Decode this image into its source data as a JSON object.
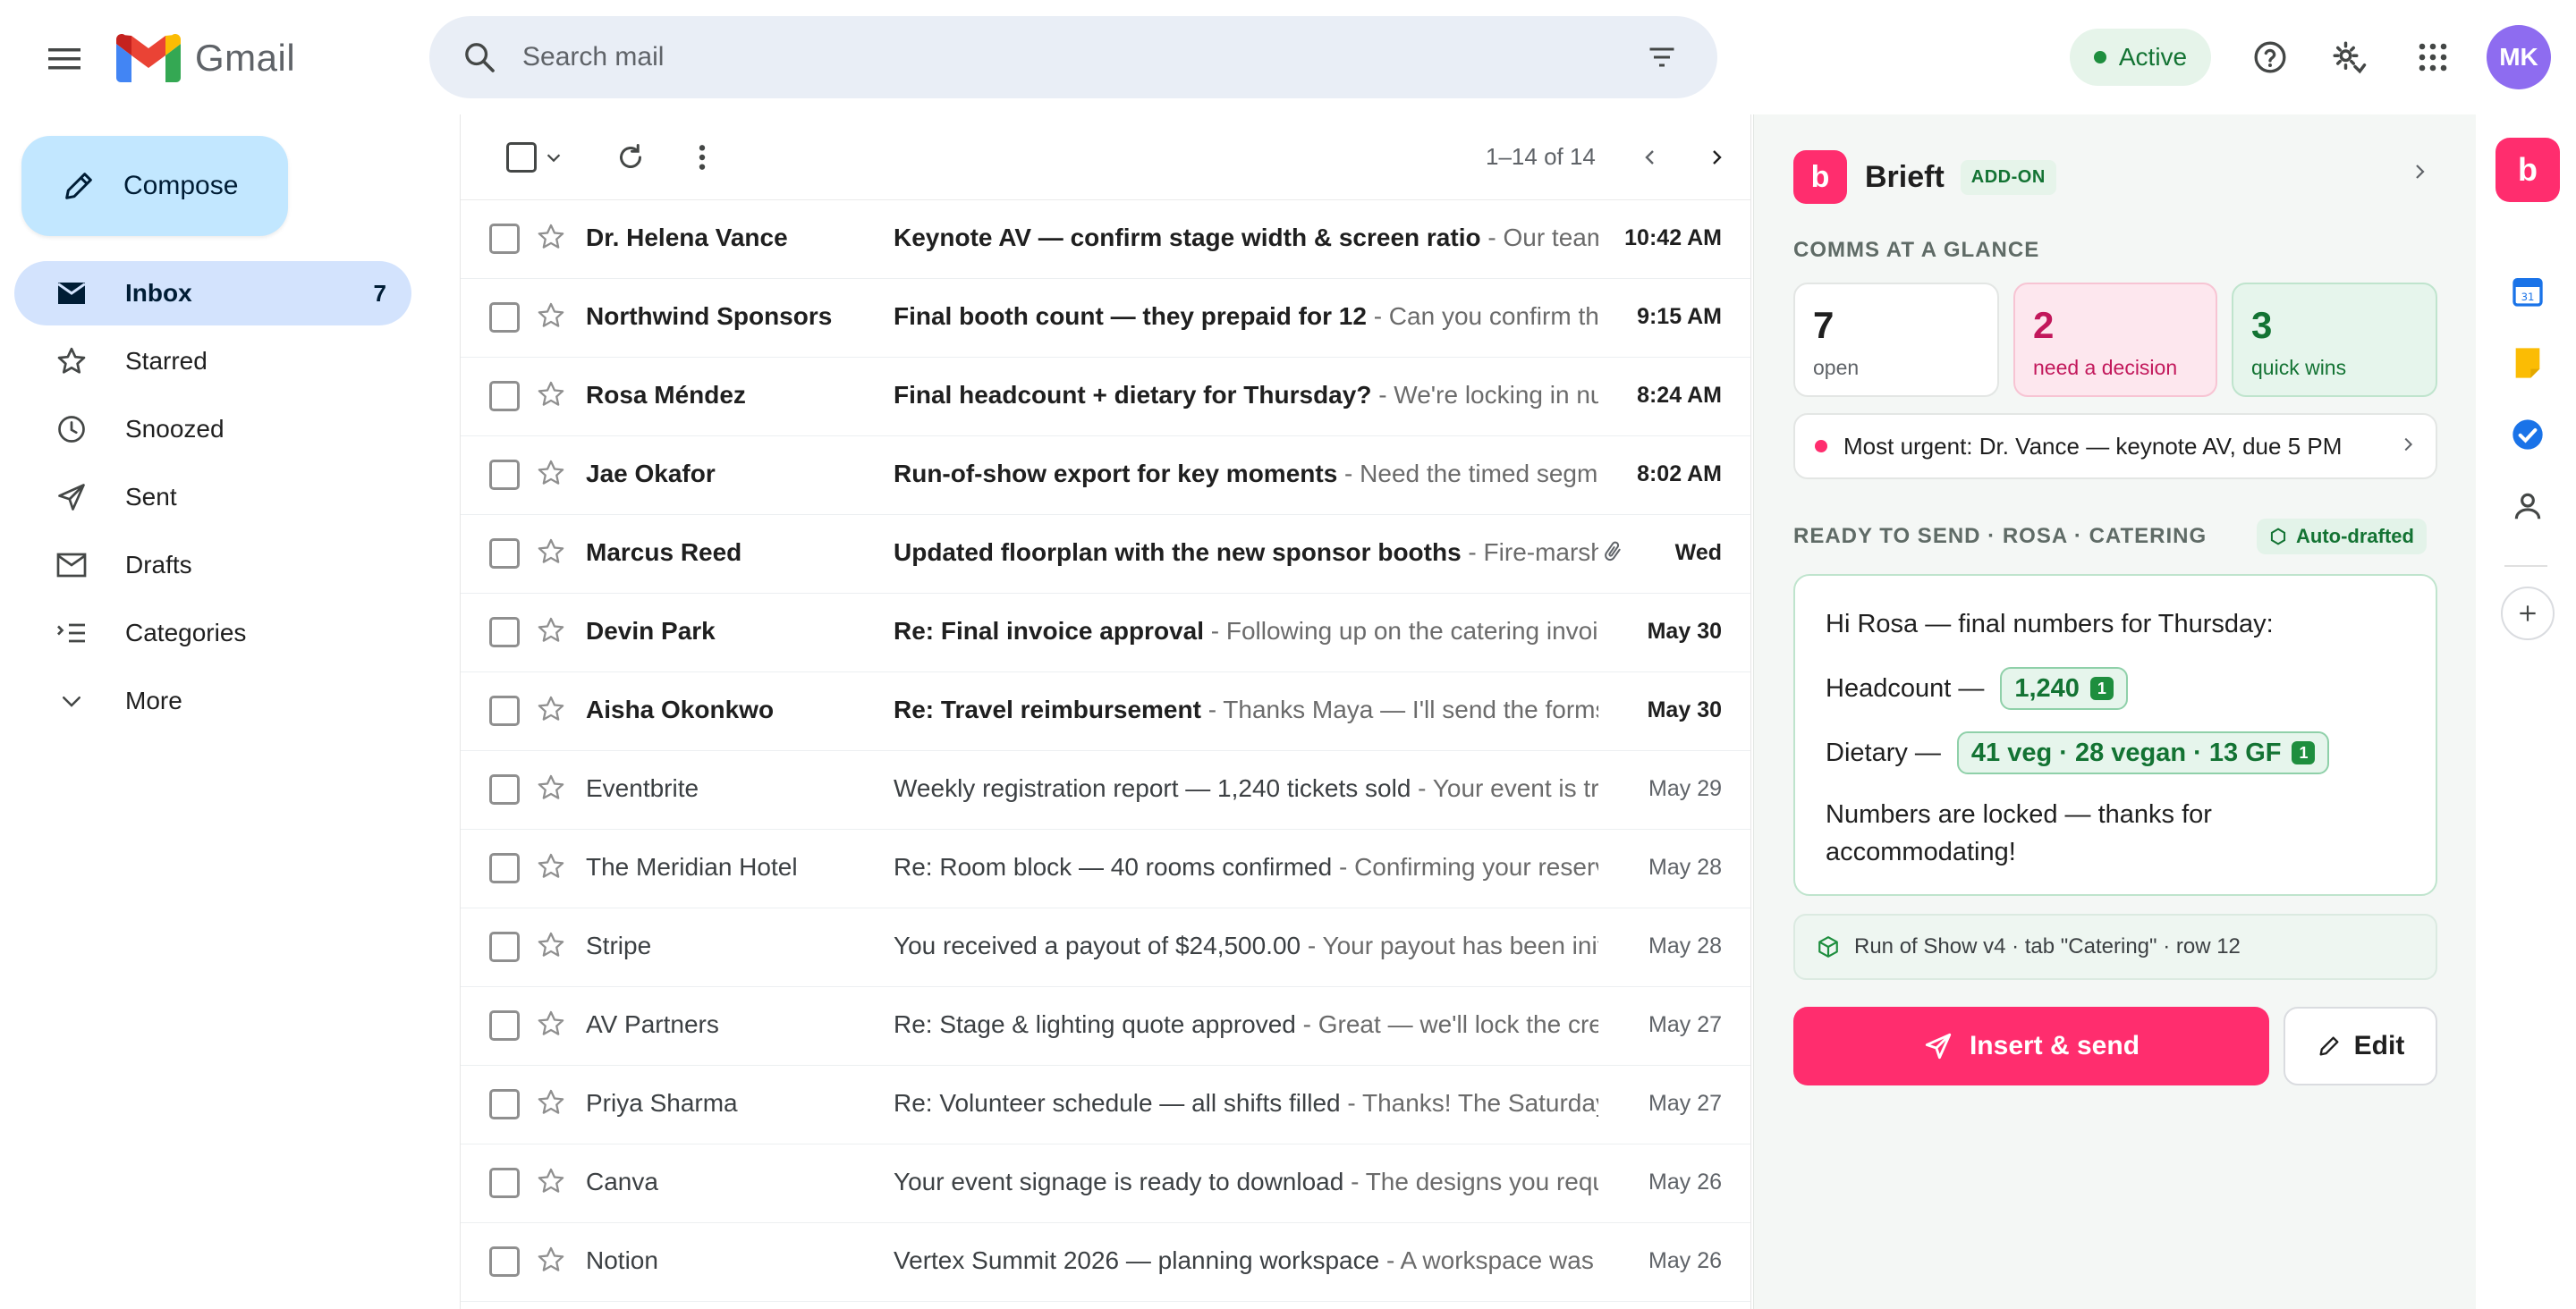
{
  "app": {
    "name": "Gmail"
  },
  "header": {
    "search_placeholder": "Search mail",
    "status_label": "Active",
    "avatar_initials": "MK"
  },
  "compose": {
    "label": "Compose"
  },
  "nav": {
    "items": [
      {
        "label": "Inbox",
        "count": "7",
        "icon": "inbox-icon"
      },
      {
        "label": "Starred",
        "count": "",
        "icon": "star-icon"
      },
      {
        "label": "Snoozed",
        "count": "",
        "icon": "clock-icon"
      },
      {
        "label": "Sent",
        "count": "",
        "icon": "send-icon"
      },
      {
        "label": "Drafts",
        "count": "",
        "icon": "draft-icon"
      },
      {
        "label": "Categories",
        "count": "",
        "icon": "label-icon"
      },
      {
        "label": "More",
        "count": "",
        "icon": "chevron-down-icon"
      }
    ]
  },
  "toolbar": {
    "pager": "1–14 of 14"
  },
  "emails": [
    {
      "sender": "Dr. Helena Vance",
      "subject": "Keynote AV — confirm stage width & screen ratio",
      "snippet": " - Our team needs the final stage dimensions",
      "date": "10:42 AM",
      "unread": true,
      "attachment": false
    },
    {
      "sender": "Northwind Sponsors",
      "subject": "Final booth count — they prepaid for 12",
      "snippet": " - Can you confirm the booth allocation",
      "date": "9:15 AM",
      "unread": true,
      "attachment": false
    },
    {
      "sender": "Rosa Méndez",
      "subject": "Final headcount + dietary for Thursday?",
      "snippet": " - We're locking in numbers today",
      "date": "8:24 AM",
      "unread": true,
      "attachment": false
    },
    {
      "sender": "Jae Okafor",
      "subject": "Run-of-show export for key moments",
      "snippet": " - Need the timed segments by tonight",
      "date": "8:02 AM",
      "unread": true,
      "attachment": false
    },
    {
      "sender": "Marcus Reed",
      "subject": "Updated floorplan with the new sponsor booths",
      "snippet": " - Fire-marshal approved layout attached",
      "date": "Wed",
      "unread": true,
      "attachment": true
    },
    {
      "sender": "Devin Park",
      "subject": "Re: Final invoice approval",
      "snippet": " - Following up on the catering invoice",
      "date": "May 30",
      "unread": true,
      "attachment": false
    },
    {
      "sender": "Aisha Okonkwo",
      "subject": "Re: Travel reimbursement",
      "snippet": " - Thanks Maya — I'll send the forms over",
      "date": "May 30",
      "unread": true,
      "attachment": false
    },
    {
      "sender": "Eventbrite",
      "subject": "Weekly registration report — 1,240 tickets sold",
      "snippet": " - Your event is trending up this week",
      "date": "May 29",
      "unread": false,
      "attachment": false
    },
    {
      "sender": "The Meridian Hotel",
      "subject": "Re: Room block — 40 rooms confirmed",
      "snippet": " - Confirming your reservation details",
      "date": "May 28",
      "unread": false,
      "attachment": false
    },
    {
      "sender": "Stripe",
      "subject": "You received a payout of $24,500.00",
      "snippet": " - Your payout has been initiated",
      "date": "May 28",
      "unread": false,
      "attachment": false
    },
    {
      "sender": "AV Partners",
      "subject": "Re: Stage & lighting quote approved",
      "snippet": " - Great — we'll lock the crew schedule",
      "date": "May 27",
      "unread": false,
      "attachment": false
    },
    {
      "sender": "Priya Sharma",
      "subject": "Re: Volunteer schedule — all shifts filled",
      "snippet": " - Thanks! The Saturday team is set",
      "date": "May 27",
      "unread": false,
      "attachment": false
    },
    {
      "sender": "Canva",
      "subject": "Your event signage is ready to download",
      "snippet": " - The designs you requested are ready",
      "date": "May 26",
      "unread": false,
      "attachment": false
    },
    {
      "sender": "Notion",
      "subject": "Vertex Summit 2026 — planning workspace",
      "snippet": " - A workspace was shared with you",
      "date": "May 26",
      "unread": false,
      "attachment": false
    }
  ],
  "panel": {
    "title": "Brieft",
    "badge": "ADD-ON",
    "glance_heading": "COMMS AT A GLANCE",
    "stats": [
      {
        "value": "7",
        "label": "open"
      },
      {
        "value": "2",
        "label": "need a decision"
      },
      {
        "value": "3",
        "label": "quick wins"
      }
    ],
    "urgent_text": "Most urgent: Dr. Vance — keynote AV, due 5 PM",
    "ready_heading": "READY TO SEND · ROSA · CATERING",
    "autodraft_label": "Auto-drafted",
    "draft": {
      "greeting": "Hi Rosa — final numbers for Thursday:",
      "headcount_label": "Headcount —",
      "headcount_value": "1,240",
      "headcount_sources": "1",
      "dietary_label": "Dietary —",
      "dietary_value": "41 veg · 28 vegan · 13 GF",
      "dietary_sources": "1",
      "closing": "Numbers are locked — thanks for accommodating!"
    },
    "source_text": "Run of Show v4 · tab \"Catering\" · row 12",
    "send_label": "Insert & send",
    "edit_label": "Edit"
  },
  "rail": {
    "addon_letter": "b",
    "panel_logo_letter": "b"
  },
  "colors": {
    "brand_pink": "#ff2d6e",
    "success_green": "#137333",
    "compose_blue": "#c2e7ff"
  }
}
